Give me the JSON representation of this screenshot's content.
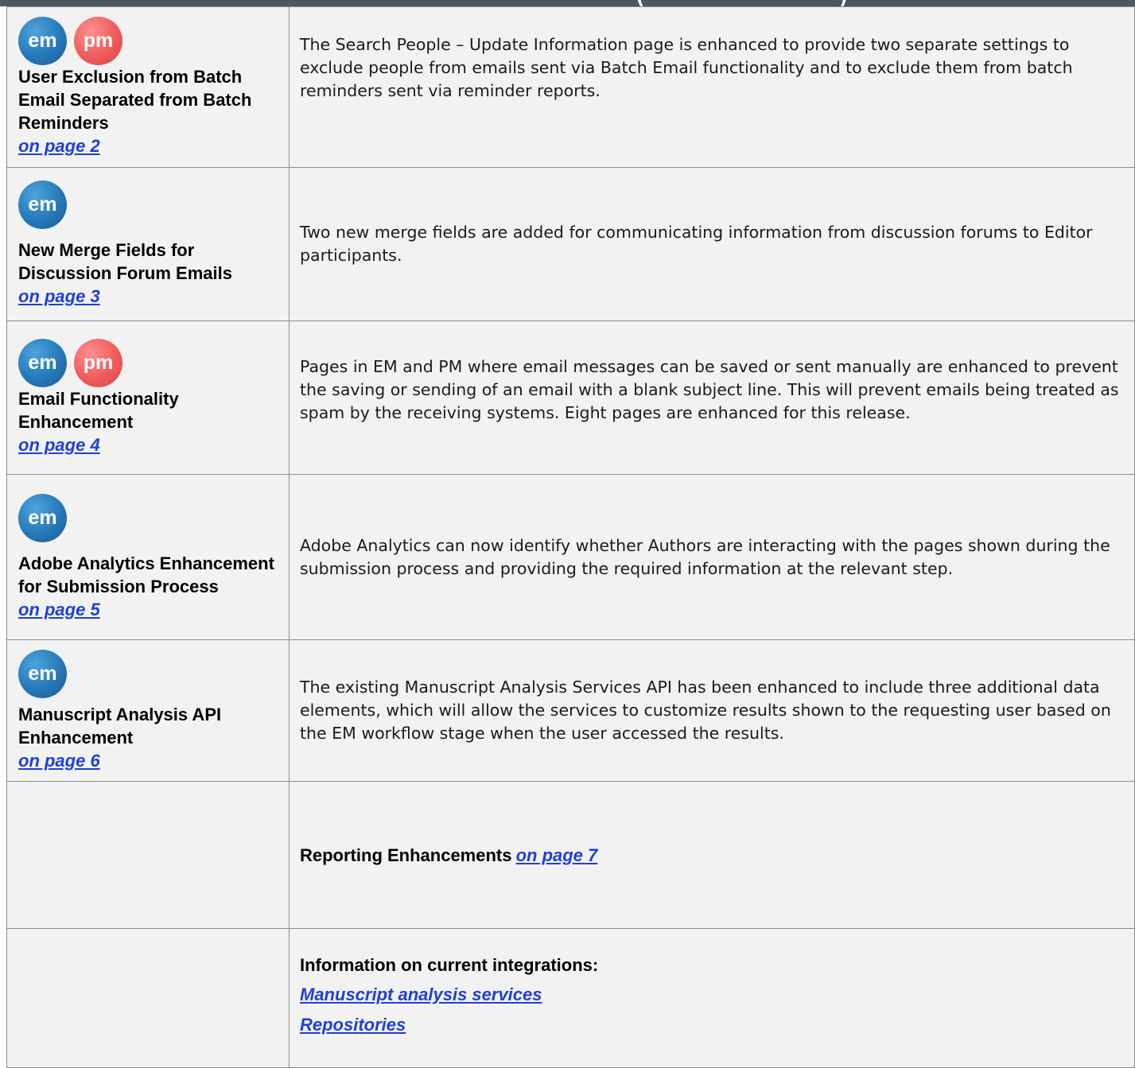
{
  "header": {
    "title_fragment": "(                              )"
  },
  "rows": [
    {
      "badges": [
        "em",
        "pm"
      ],
      "title": "User Exclusion from Batch Email Separated from Batch Reminders",
      "link": "on page 2",
      "description": "The Search People – Update Information page is enhanced to provide two separate settings to exclude people from emails sent via Batch Email functionality and to exclude them from batch reminders sent via reminder reports."
    },
    {
      "badges": [
        "em"
      ],
      "title": "New Merge Fields for Discussion Forum Emails",
      "link": "on page 3",
      "description": "Two new merge fields are added for communicating information from discussion forums to Editor participants."
    },
    {
      "badges": [
        "em",
        "pm"
      ],
      "title": "Email Functionality Enhancement",
      "link": "on page 4",
      "description": "Pages in EM and PM where email messages can be saved or sent manually are enhanced to prevent the saving or sending of an email with a blank subject line. This will prevent emails being treated as spam by the receiving systems. Eight pages are enhanced for this release."
    },
    {
      "badges": [
        "em"
      ],
      "title": "Adobe Analytics Enhancement for Submission Process",
      "link": "on page 5",
      "description": "Adobe Analytics can now identify whether Authors are interacting with the pages shown during the submission process and providing the required information at the relevant step."
    },
    {
      "badges": [
        "em"
      ],
      "title": "Manuscript Analysis API Enhancement",
      "link": "on page 6",
      "description": "The existing Manuscript Analysis Services API has been enhanced to include three additional data elements, which will allow the services to customize results shown to the requesting user based on the EM workflow stage when the user accessed the results."
    }
  ],
  "reporting": {
    "label": "Reporting Enhancements",
    "link": "on page 7"
  },
  "integrations": {
    "heading": "Information on current integrations:",
    "links": [
      "Manuscript analysis services",
      "Repositories"
    ]
  }
}
